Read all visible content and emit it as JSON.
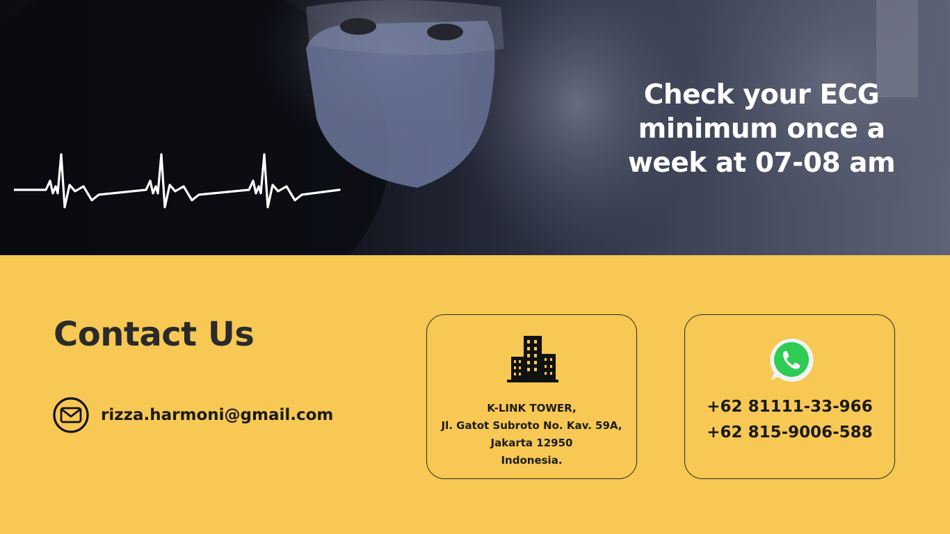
{
  "hero": {
    "headline_lines": [
      "Check your ECG",
      "minimum once a",
      "week at 07-08 am"
    ]
  },
  "contact": {
    "title": "Contact Us",
    "email": "rizza.harmoni@gmail.com",
    "address": {
      "lines": [
        "K-LINK TOWER,",
        "Jl. Gatot Subroto No. Kav. 59A,",
        "Jakarta 12950",
        "Indonesia."
      ]
    },
    "phones": [
      "+62 81111-33-966",
      "+62 815-9006-588"
    ]
  },
  "icons": {
    "email": "envelope-icon",
    "address": "building-icon",
    "phone": "whatsapp-icon",
    "ecg": "heartbeat-line"
  },
  "colors": {
    "contact_background": "#f7c853",
    "headline": "#ffffff",
    "text_dark": "#1b1b1b",
    "whatsapp_green": "#2ecc55"
  }
}
